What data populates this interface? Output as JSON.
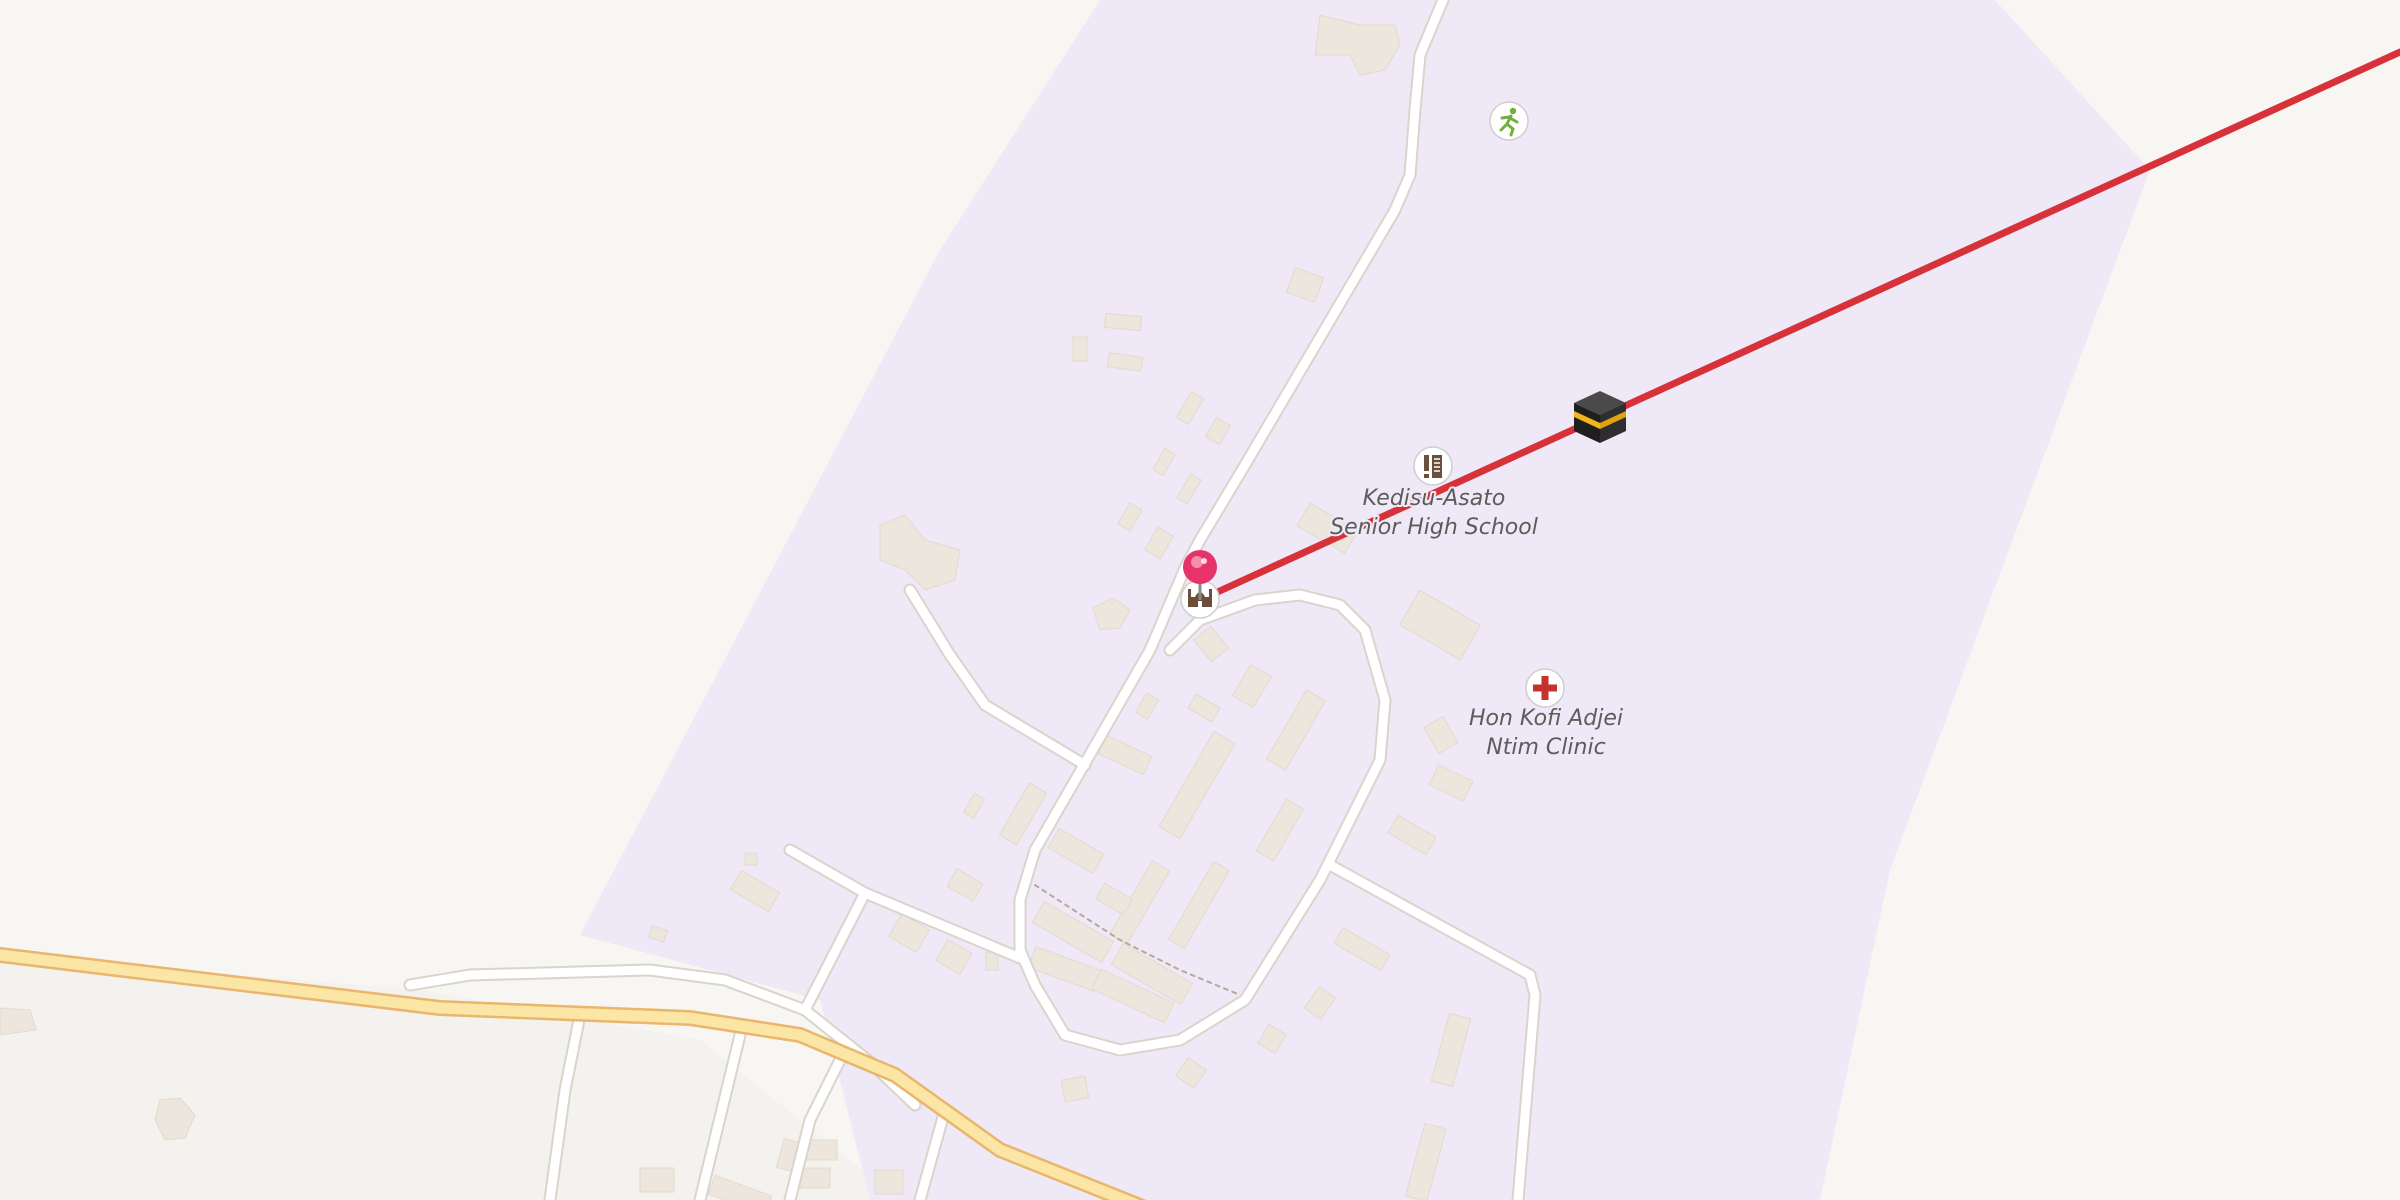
{
  "map": {
    "colors": {
      "background": "#f8f6f2",
      "school_area": "#efe8f7",
      "residential": "#f4f2ee",
      "building": "#ece6dd",
      "minor_road": "#ffffff",
      "main_road_fill": "#fbe6a6",
      "main_road_casing": "#eab56c",
      "route_line": "#d7323a",
      "marker": "#e8336a"
    },
    "pois": [
      {
        "name": "Kedisu-Asato Senior High School",
        "label_line1": "Kedisu-Asato",
        "label_line2": "Senior High School",
        "icon": "school-icon"
      },
      {
        "name": "Hon Kofi Adjei Ntim Clinic",
        "label_line1": "Hon Kofi Adjei",
        "label_line2": "Ntim Clinic",
        "icon": "clinic-cross-icon"
      },
      {
        "name": "sports",
        "icon": "running-person-icon"
      },
      {
        "name": "mosque",
        "icon": "mosque-icon"
      }
    ],
    "route": {
      "destination_icon": "kaaba-icon",
      "origin_icon": "location-pin-icon"
    }
  }
}
